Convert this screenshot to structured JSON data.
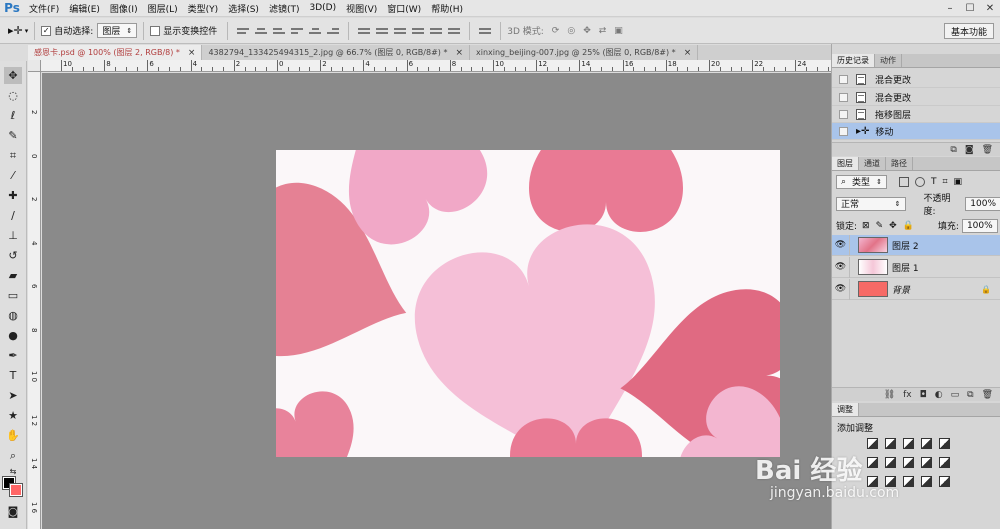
{
  "app": {
    "logo": "Ps"
  },
  "menu": [
    "文件(F)",
    "编辑(E)",
    "图像(I)",
    "图层(L)",
    "类型(Y)",
    "选择(S)",
    "滤镜(T)",
    "3D(D)",
    "视图(V)",
    "窗口(W)",
    "帮助(H)"
  ],
  "options": {
    "auto_select_label": "自动选择:",
    "auto_select_checked": "✓",
    "auto_select_target": "图层",
    "show_transform_label": "显示变换控件",
    "mode_3d_label": "3D 模式:",
    "workspace": "基本功能"
  },
  "tabs": [
    {
      "label": "感恩卡.psd @ 100% (图层 2, RGB/8) *",
      "close": "×"
    },
    {
      "label": "4382794_133425494315_2.jpg @ 66.7% (图层 0, RGB/8#) *",
      "close": "×"
    },
    {
      "label": "xinxing_beijing-007.jpg @ 25% (图层 0, RGB/8#) *",
      "close": "×"
    }
  ],
  "ruler_h": [
    "10",
    "8",
    "6",
    "4",
    "2",
    "0",
    "2",
    "4",
    "6",
    "8",
    "10",
    "12",
    "14",
    "16",
    "18",
    "20",
    "22",
    "24"
  ],
  "ruler_v": [
    "2",
    "0",
    "2",
    "4",
    "6",
    "8",
    "1 0",
    "1 2",
    "1 4",
    "1 6"
  ],
  "history": {
    "tabs": [
      "历史记录",
      "动作"
    ],
    "items": [
      "混合更改",
      "混合更改",
      "拖移图层",
      "移动"
    ]
  },
  "layers": {
    "tabs": [
      "图层",
      "通道",
      "路径"
    ],
    "filter_type": "类型",
    "blend_mode": "正常",
    "opacity_label": "不透明度:",
    "opacity": "100%",
    "lock_label": "锁定:",
    "fill_label": "填充:",
    "fill": "100%",
    "items": [
      {
        "name": "图层 2",
        "selected": true
      },
      {
        "name": "图层 1",
        "selected": false
      },
      {
        "name": "背景",
        "selected": false,
        "locked": true
      }
    ]
  },
  "adjustments": {
    "tab": "调整",
    "title": "添加调整"
  },
  "watermark": {
    "brand": "Bai 经验",
    "url": "jingyan.baidu.com"
  },
  "colors": {
    "foreground": "#000000",
    "background": "#ff6666",
    "heart_dark": "#e0657c",
    "heart_light": "#f7bcd6"
  }
}
